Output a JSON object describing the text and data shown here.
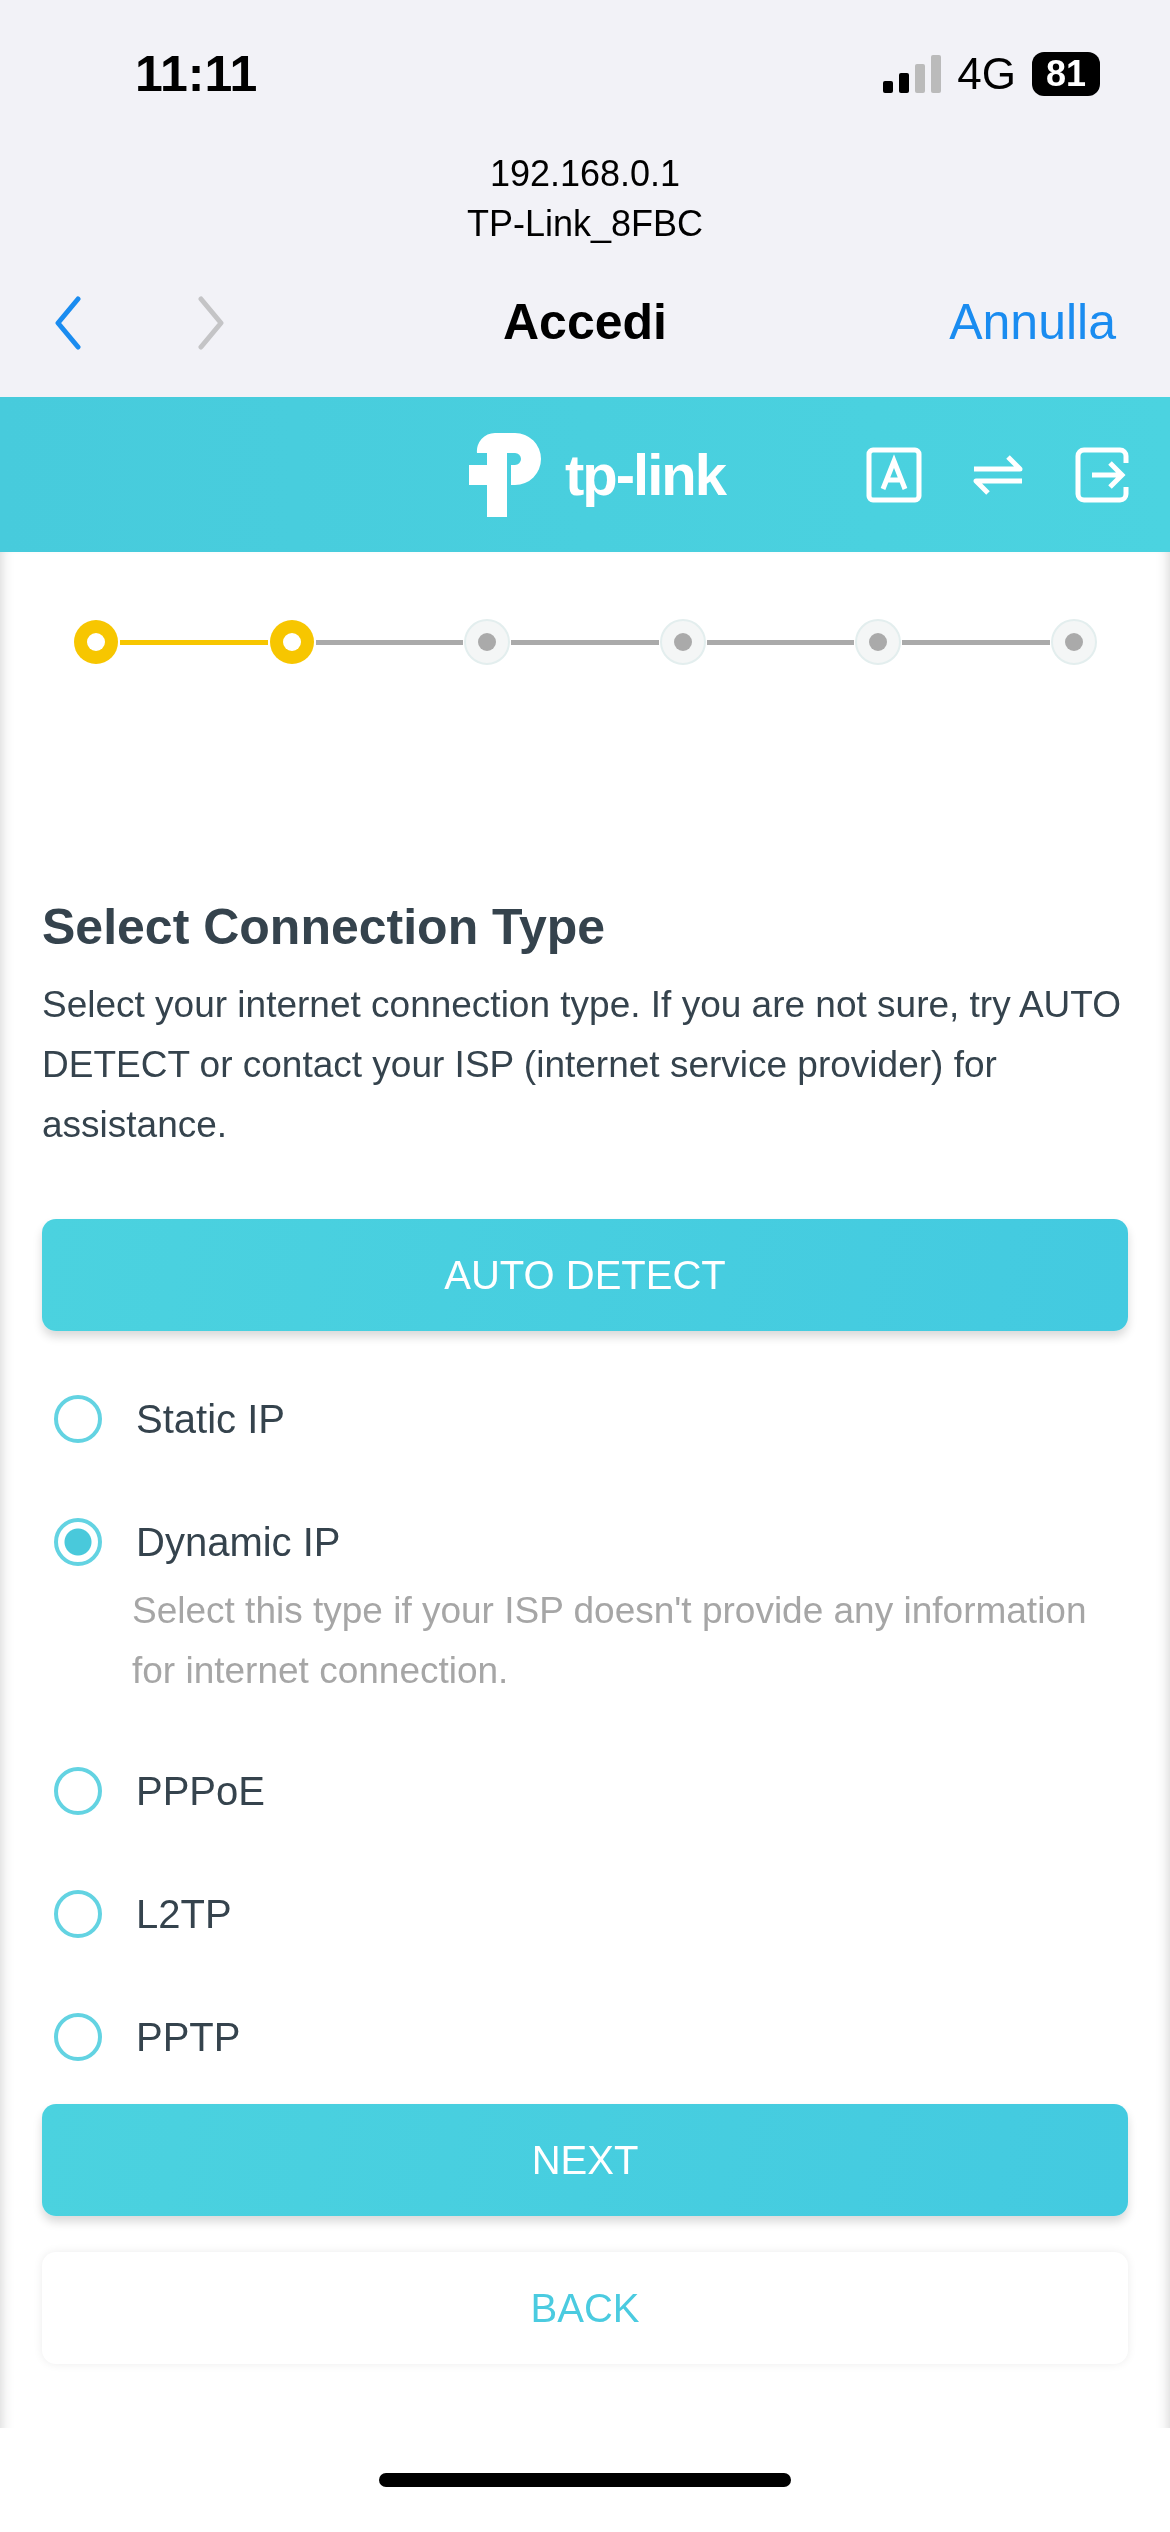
{
  "status_bar": {
    "time": "11:11",
    "network": "4G",
    "battery": "81"
  },
  "browser": {
    "url": "192.168.0.1",
    "network_name": "TP-Link_8FBC",
    "title": "Accedi",
    "cancel": "Annulla",
    "back_enabled": true,
    "forward_enabled": false
  },
  "header": {
    "logo_text": "tp-link"
  },
  "stepper": [
    {
      "done": true
    },
    {
      "done": true
    },
    {
      "done": false
    },
    {
      "done": false
    },
    {
      "done": false
    },
    {
      "done": false
    }
  ],
  "heading": "Select Connection Type",
  "description": "Select your internet connection type. If you are not sure, try AUTO DETECT or contact your ISP (internet service provider) for assistance.",
  "auto_detect_button": "AUTO DETECT",
  "options": [
    {
      "label": "Static IP",
      "selected": false
    },
    {
      "label": "Dynamic IP",
      "selected": true,
      "description": "Select this type if your ISP doesn't provide any information for internet connection."
    },
    {
      "label": "PPPoE",
      "selected": false
    },
    {
      "label": "L2TP",
      "selected": false
    },
    {
      "label": "PPTP",
      "selected": false
    }
  ],
  "buttons": {
    "next": "NEXT",
    "back": "BACK"
  }
}
